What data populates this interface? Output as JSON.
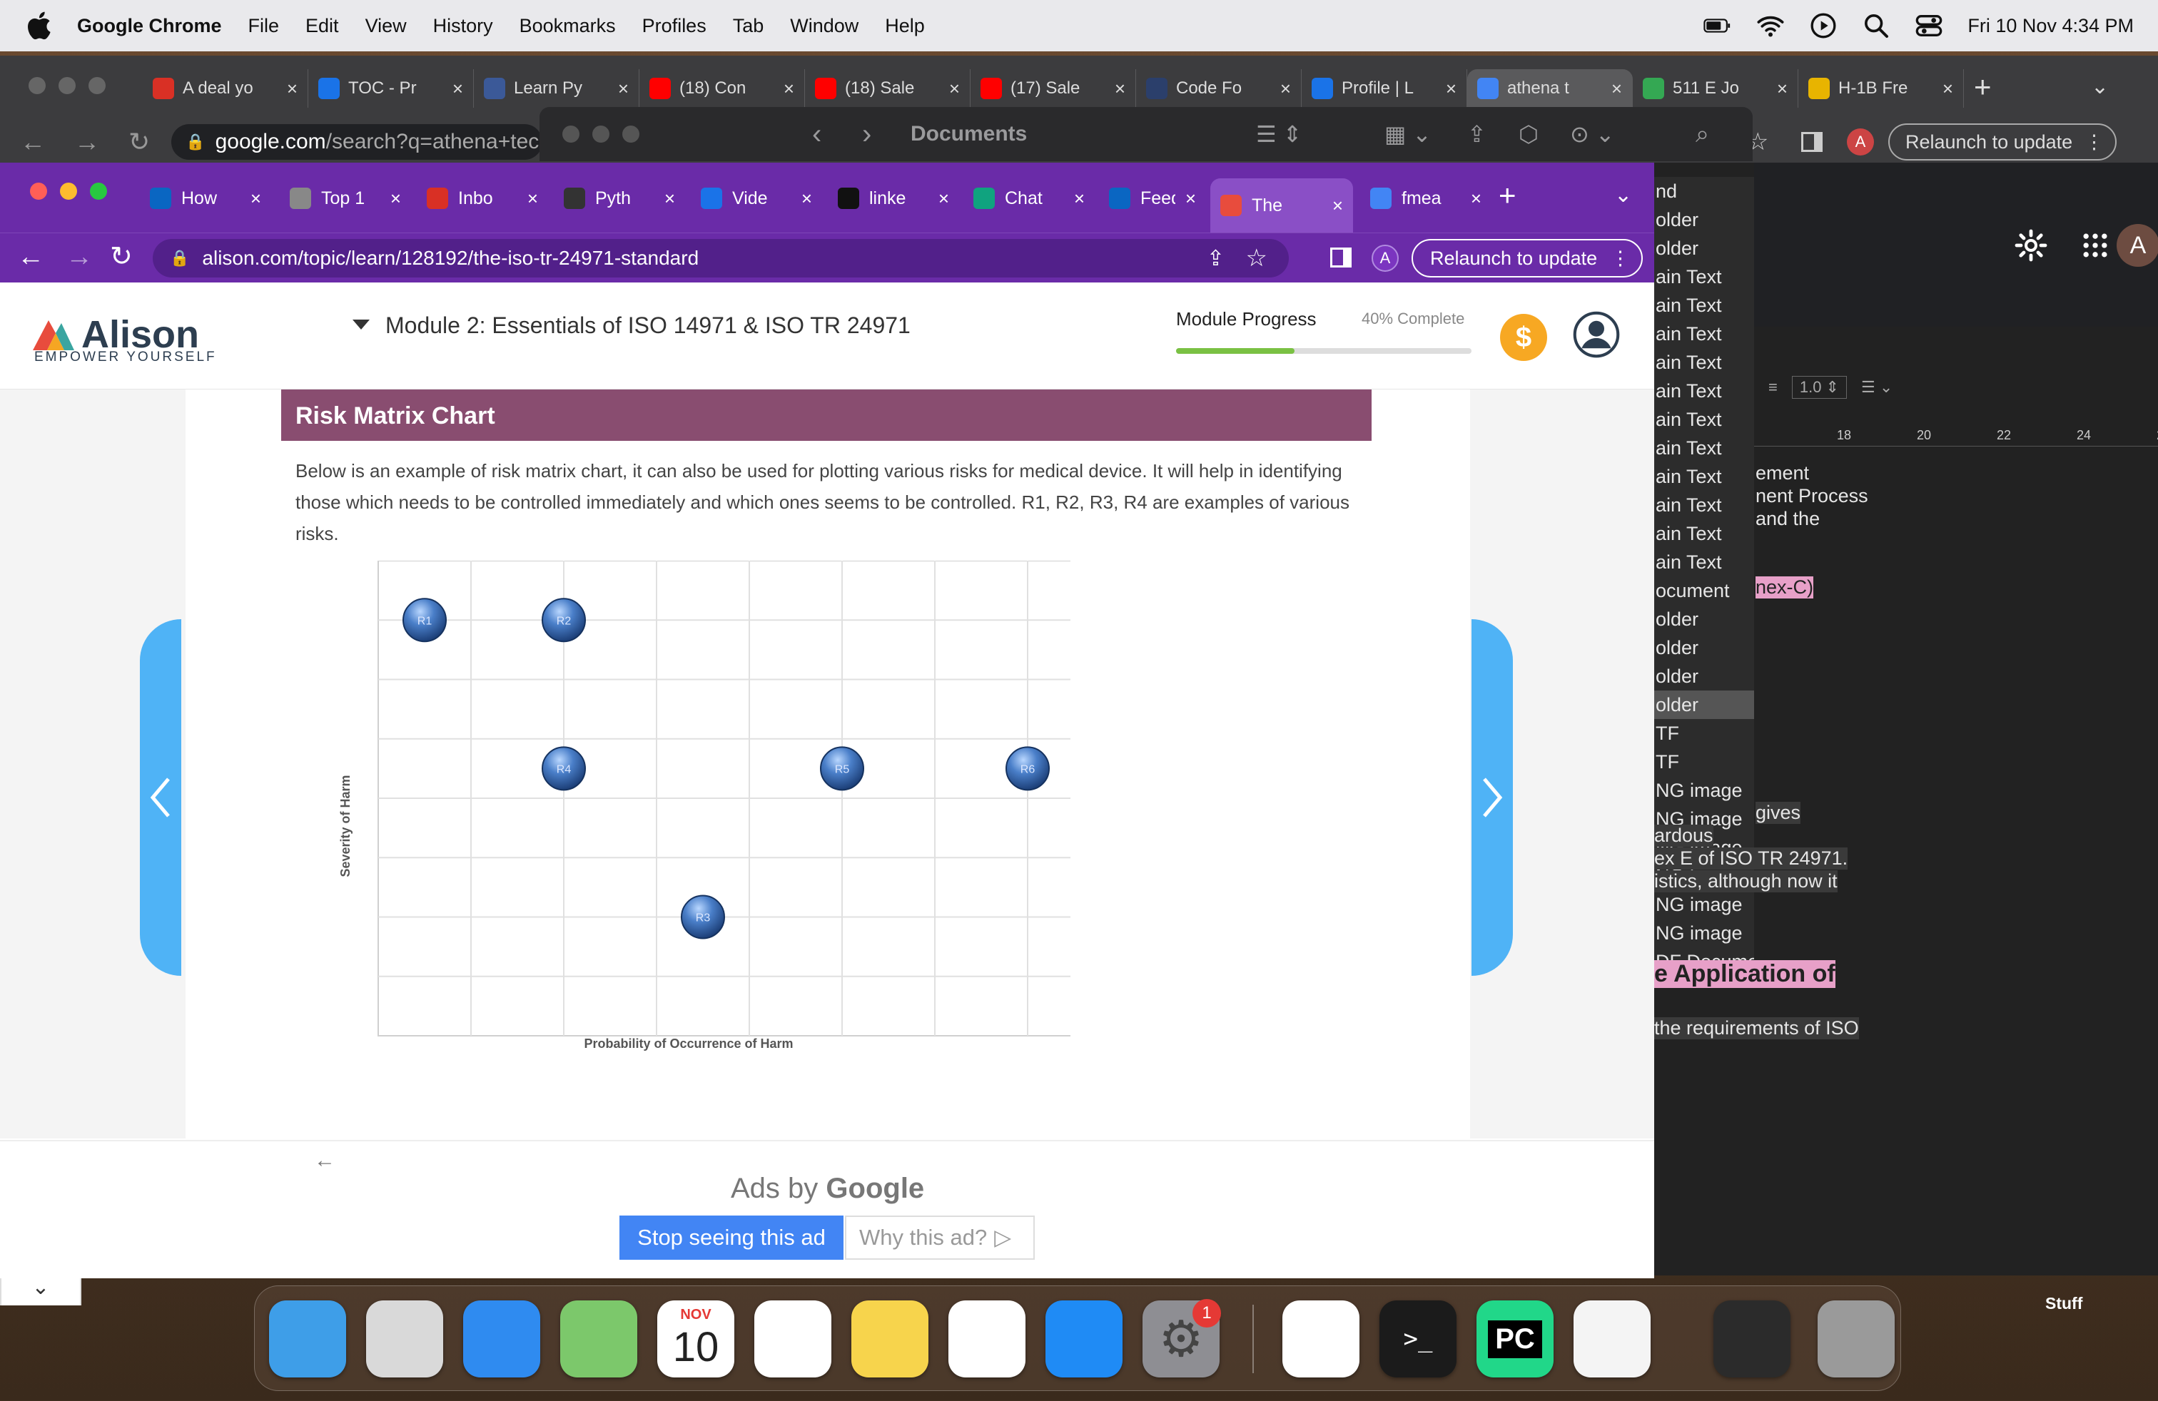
{
  "menubar": {
    "app_name": "Google Chrome",
    "items": [
      "File",
      "Edit",
      "View",
      "History",
      "Bookmarks",
      "Profiles",
      "Tab",
      "Window",
      "Help"
    ],
    "datetime": "Fri 10 Nov  4:34 PM"
  },
  "back_window": {
    "tabs": [
      {
        "label": "A deal yo",
        "icon": "gmail-icon",
        "color": "#d93025"
      },
      {
        "label": "TOC - Pr",
        "icon": "check-icon",
        "color": "#1a73e8"
      },
      {
        "label": "Learn Py",
        "icon": "blue-icon",
        "color": "#3b5998"
      },
      {
        "label": "(18) Con",
        "icon": "youtube-icon",
        "color": "#ff0000"
      },
      {
        "label": "(18) Sale",
        "icon": "youtube-icon",
        "color": "#ff0000"
      },
      {
        "label": "(17) Sale",
        "icon": "youtube-icon",
        "color": "#ff0000"
      },
      {
        "label": "Code Fo",
        "icon": "blue-icon",
        "color": "#2b3f6b"
      },
      {
        "label": "Profile | L",
        "icon": "check-icon",
        "color": "#1a73e8"
      },
      {
        "label": "athena t",
        "icon": "google-icon",
        "color": "#4285f4"
      },
      {
        "label": "511 E Jo",
        "icon": "maps-icon",
        "color": "#34a853"
      },
      {
        "label": "H-1B Fre",
        "icon": "cal-icon",
        "color": "#e8b400"
      }
    ],
    "url_host": "google.com",
    "url_path": "/search?q=athena+tech",
    "relaunch_label": "Relaunch to update",
    "profile_initial": "A"
  },
  "finder": {
    "title": "Documents"
  },
  "dark_pane": {
    "list_items": [
      "nd",
      "older",
      "older",
      "ain Text",
      "ain Text",
      "ain Text",
      "ain Text",
      "ain Text",
      "ain Text",
      "ain Text",
      "ain Text",
      "ain Text",
      "ain Text",
      "ain Text",
      "ocument",
      "older",
      "older",
      "older",
      "older",
      "TF",
      "TF",
      "NG image",
      "NG image",
      "NG image",
      "NG image",
      "NG image",
      "NG image",
      "DF Docume"
    ],
    "ruler": [
      "18",
      "20",
      "22",
      "24",
      "26"
    ],
    "spacing_value": "1.0",
    "doc_lines": [
      "ement",
      "nent Process",
      "and the",
      "nex-C)",
      "gives",
      "ardous",
      "ex E of ISO TR 24971.",
      "istics, although now it",
      "e Application of",
      "the requirements of ISO"
    ],
    "profile_initial": "A"
  },
  "front_window": {
    "tabs": [
      {
        "label": "How",
        "icon": "linkedin-icon",
        "color": "#0a66c2"
      },
      {
        "label": "Top 1",
        "icon": "compass-icon",
        "color": "#888"
      },
      {
        "label": "Inbo",
        "icon": "gmail-icon",
        "color": "#d93025"
      },
      {
        "label": "Pyth",
        "icon": "github-icon",
        "color": "#333"
      },
      {
        "label": "Vide",
        "icon": "check-icon",
        "color": "#1a73e8"
      },
      {
        "label": "linke",
        "icon": "github-icon",
        "color": "#111"
      },
      {
        "label": "Chat",
        "icon": "chatgpt-icon",
        "color": "#10a37f"
      },
      {
        "label": "Feed",
        "icon": "linkedin-icon",
        "color": "#0a66c2"
      },
      {
        "label": "The",
        "icon": "alison-icon",
        "color": "#e84c3d"
      },
      {
        "label": "fmea",
        "icon": "google-icon",
        "color": "#4285f4"
      }
    ],
    "url": "alison.com/topic/learn/128192/the-iso-tr-24971-standard",
    "relaunch_label": "Relaunch to update",
    "profile_initial": "A"
  },
  "page": {
    "logo_name": "Alison",
    "logo_tagline": "EMPOWER YOURSELF",
    "module_title": "Module 2: Essentials of ISO 14971 & ISO TR 24971",
    "progress_label": "Module Progress",
    "progress_text": "40% Complete",
    "progress_fraction": 0.4,
    "section_title": "Risk Matrix Chart",
    "paragraph": "Below is an example of risk matrix chart, it can also be used for plotting various risks for medical device. It will help in identifying those which needs to be controlled immediately and which ones seems to be controlled. R1, R2, R3, R4 are examples of various risks.",
    "ads_label_prefix": "Ads by ",
    "ads_label_brand": "Google",
    "stop_ad": "Stop seeing this ad",
    "why_ad": "Why this ad?"
  },
  "chart_data": {
    "type": "scatter",
    "xlabel": "Probability of Occurrence of Harm",
    "ylabel": "Severity of Harm",
    "grid": true,
    "grid_columns": 8,
    "grid_rows": 8,
    "xlim": [
      0,
      8
    ],
    "ylim": [
      0,
      8
    ],
    "points": [
      {
        "label": "R1",
        "x": 0.5,
        "y": 7
      },
      {
        "label": "R2",
        "x": 2,
        "y": 7
      },
      {
        "label": "R4",
        "x": 2,
        "y": 4.5
      },
      {
        "label": "R5",
        "x": 5,
        "y": 4.5
      },
      {
        "label": "R6",
        "x": 7,
        "y": 4.5
      },
      {
        "label": "R3",
        "x": 3.5,
        "y": 2
      }
    ]
  },
  "dock": {
    "apps": [
      "Finder",
      "Launchpad",
      "Safari",
      "Maps",
      "Calendar",
      "Reminders",
      "Notes",
      "Freeform",
      "App Store",
      "System Settings",
      "Chrome",
      "Terminal",
      "PyCharm",
      "TextEdit",
      "Preview",
      "Trash"
    ],
    "calendar_month": "NOV",
    "calendar_day": "10",
    "settings_badge": "1",
    "stack_label": "Stuff"
  }
}
